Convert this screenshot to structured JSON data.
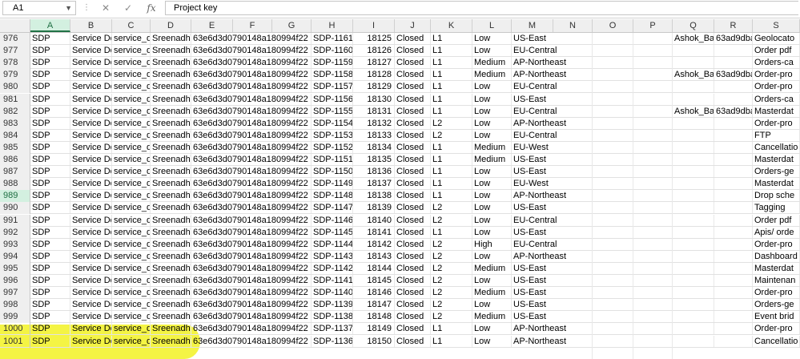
{
  "formula_bar": {
    "name_box": "A1",
    "formula": "Project key",
    "cancel_icon": "✕",
    "enter_icon": "✓",
    "function_icon": "fx"
  },
  "columns": [
    "A",
    "B",
    "C",
    "D",
    "E",
    "F",
    "G",
    "H",
    "I",
    "J",
    "K",
    "L",
    "M",
    "N",
    "O",
    "P",
    "Q",
    "R",
    "S"
  ],
  "active_column": "A",
  "active_row": "989",
  "rows": [
    {
      "n": "976",
      "a": "SDP",
      "b": "Service De",
      "c": "service_de",
      "d": "Sreenadh\\",
      "e": "63e6d3d0790148a180994f22",
      "h": "SDP-1161",
      "i": "18125",
      "j": "Closed",
      "k": "L1",
      "l": "Low",
      "m": "US-East",
      "q": "Ashok_Ba",
      "r": "63ad9dba",
      "s": "Geolocato"
    },
    {
      "n": "977",
      "a": "SDP",
      "b": "Service De",
      "c": "service_de",
      "d": "Sreenadh\\",
      "e": "63e6d3d0790148a180994f22",
      "h": "SDP-1160",
      "i": "18126",
      "j": "Closed",
      "k": "L1",
      "l": "Low",
      "m": "EU-Central",
      "q": "",
      "r": "",
      "s": "Order pdf"
    },
    {
      "n": "978",
      "a": "SDP",
      "b": "Service De",
      "c": "service_de",
      "d": "Sreenadh\\",
      "e": "63e6d3d0790148a180994f22",
      "h": "SDP-1159",
      "i": "18127",
      "j": "Closed",
      "k": "L1",
      "l": "Medium",
      "m": "AP-Northeast",
      "q": "",
      "r": "",
      "s": "Orders-ca"
    },
    {
      "n": "979",
      "a": "SDP",
      "b": "Service De",
      "c": "service_de",
      "d": "Sreenadh\\",
      "e": "63e6d3d0790148a180994f22",
      "h": "SDP-1158",
      "i": "18128",
      "j": "Closed",
      "k": "L1",
      "l": "Medium",
      "m": "AP-Northeast",
      "q": "Ashok_Ba",
      "r": "63ad9dba",
      "s": "Order-pro"
    },
    {
      "n": "980",
      "a": "SDP",
      "b": "Service De",
      "c": "service_de",
      "d": "Sreenadh\\",
      "e": "63e6d3d0790148a180994f22",
      "h": "SDP-1157",
      "i": "18129",
      "j": "Closed",
      "k": "L1",
      "l": "Low",
      "m": "EU-Central",
      "q": "",
      "r": "",
      "s": "Order-pro"
    },
    {
      "n": "981",
      "a": "SDP",
      "b": "Service De",
      "c": "service_de",
      "d": "Sreenadh\\",
      "e": "63e6d3d0790148a180994f22",
      "h": "SDP-1156",
      "i": "18130",
      "j": "Closed",
      "k": "L1",
      "l": "Low",
      "m": "US-East",
      "q": "",
      "r": "",
      "s": "Orders-ca"
    },
    {
      "n": "982",
      "a": "SDP",
      "b": "Service De",
      "c": "service_de",
      "d": "Sreenadh\\",
      "e": "63e6d3d0790148a180994f22",
      "h": "SDP-1155",
      "i": "18131",
      "j": "Closed",
      "k": "L1",
      "l": "Low",
      "m": "EU-Central",
      "q": "Ashok_Ba",
      "r": "63ad9dba",
      "s": "Masterdat"
    },
    {
      "n": "983",
      "a": "SDP",
      "b": "Service De",
      "c": "service_de",
      "d": "Sreenadh\\",
      "e": "63e6d3d0790148a180994f22",
      "h": "SDP-1154",
      "i": "18132",
      "j": "Closed",
      "k": "L2",
      "l": "Low",
      "m": "AP-Northeast",
      "q": "",
      "r": "",
      "s": "Order-pro"
    },
    {
      "n": "984",
      "a": "SDP",
      "b": "Service De",
      "c": "service_de",
      "d": "Sreenadh\\",
      "e": "63e6d3d0790148a180994f22",
      "h": "SDP-1153",
      "i": "18133",
      "j": "Closed",
      "k": "L2",
      "l": "Low",
      "m": "EU-Central",
      "q": "",
      "r": "",
      "s": "FTP"
    },
    {
      "n": "985",
      "a": "SDP",
      "b": "Service De",
      "c": "service_de",
      "d": "Sreenadh\\",
      "e": "63e6d3d0790148a180994f22",
      "h": "SDP-1152",
      "i": "18134",
      "j": "Closed",
      "k": "L1",
      "l": "Medium",
      "m": "EU-West",
      "q": "",
      "r": "",
      "s": "Cancellatio"
    },
    {
      "n": "986",
      "a": "SDP",
      "b": "Service De",
      "c": "service_de",
      "d": "Sreenadh\\",
      "e": "63e6d3d0790148a180994f22",
      "h": "SDP-1151",
      "i": "18135",
      "j": "Closed",
      "k": "L1",
      "l": "Medium",
      "m": "US-East",
      "q": "",
      "r": "",
      "s": "Masterdat"
    },
    {
      "n": "987",
      "a": "SDP",
      "b": "Service De",
      "c": "service_de",
      "d": "Sreenadh\\",
      "e": "63e6d3d0790148a180994f22",
      "h": "SDP-1150",
      "i": "18136",
      "j": "Closed",
      "k": "L1",
      "l": "Low",
      "m": "US-East",
      "q": "",
      "r": "",
      "s": "Orders-ge"
    },
    {
      "n": "988",
      "a": "SDP",
      "b": "Service De",
      "c": "service_de",
      "d": "Sreenadh\\",
      "e": "63e6d3d0790148a180994f22",
      "h": "SDP-1149",
      "i": "18137",
      "j": "Closed",
      "k": "L1",
      "l": "Low",
      "m": "EU-West",
      "q": "",
      "r": "",
      "s": "Masterdat"
    },
    {
      "n": "989",
      "a": "SDP",
      "b": "Service De",
      "c": "service_de",
      "d": "Sreenadh\\",
      "e": "63e6d3d0790148a180994f22",
      "h": "SDP-1148",
      "i": "18138",
      "j": "Closed",
      "k": "L1",
      "l": "Low",
      "m": "AP-Northeast",
      "q": "",
      "r": "",
      "s": "Drop sche"
    },
    {
      "n": "990",
      "a": "SDP",
      "b": "Service De",
      "c": "service_de",
      "d": "Sreenadh\\",
      "e": "63e6d3d0790148a180994f22",
      "h": "SDP-1147",
      "i": "18139",
      "j": "Closed",
      "k": "L2",
      "l": "Low",
      "m": "US-East",
      "q": "",
      "r": "",
      "s": "Tagging"
    },
    {
      "n": "991",
      "a": "SDP",
      "b": "Service De",
      "c": "service_de",
      "d": "Sreenadh\\",
      "e": "63e6d3d0790148a180994f22",
      "h": "SDP-1146",
      "i": "18140",
      "j": "Closed",
      "k": "L2",
      "l": "Low",
      "m": "EU-Central",
      "q": "",
      "r": "",
      "s": "Order pdf"
    },
    {
      "n": "992",
      "a": "SDP",
      "b": "Service De",
      "c": "service_de",
      "d": "Sreenadh\\",
      "e": "63e6d3d0790148a180994f22",
      "h": "SDP-1145",
      "i": "18141",
      "j": "Closed",
      "k": "L1",
      "l": "Low",
      "m": "US-East",
      "q": "",
      "r": "",
      "s": "Apis/ orde"
    },
    {
      "n": "993",
      "a": "SDP",
      "b": "Service De",
      "c": "service_de",
      "d": "Sreenadh\\",
      "e": "63e6d3d0790148a180994f22",
      "h": "SDP-1144",
      "i": "18142",
      "j": "Closed",
      "k": "L2",
      "l": "High",
      "m": "EU-Central",
      "q": "",
      "r": "",
      "s": "Order-pro"
    },
    {
      "n": "994",
      "a": "SDP",
      "b": "Service De",
      "c": "service_de",
      "d": "Sreenadh\\",
      "e": "63e6d3d0790148a180994f22",
      "h": "SDP-1143",
      "i": "18143",
      "j": "Closed",
      "k": "L2",
      "l": "Low",
      "m": "AP-Northeast",
      "q": "",
      "r": "",
      "s": "Dashboard"
    },
    {
      "n": "995",
      "a": "SDP",
      "b": "Service De",
      "c": "service_de",
      "d": "Sreenadh\\",
      "e": "63e6d3d0790148a180994f22",
      "h": "SDP-1142",
      "i": "18144",
      "j": "Closed",
      "k": "L2",
      "l": "Medium",
      "m": "US-East",
      "q": "",
      "r": "",
      "s": "Masterdat"
    },
    {
      "n": "996",
      "a": "SDP",
      "b": "Service De",
      "c": "service_de",
      "d": "Sreenadh\\",
      "e": "63e6d3d0790148a180994f22",
      "h": "SDP-1141",
      "i": "18145",
      "j": "Closed",
      "k": "L2",
      "l": "Low",
      "m": "US-East",
      "q": "",
      "r": "",
      "s": "Maintenan"
    },
    {
      "n": "997",
      "a": "SDP",
      "b": "Service De",
      "c": "service_de",
      "d": "Sreenadh\\",
      "e": "63e6d3d0790148a180994f22",
      "h": "SDP-1140",
      "i": "18146",
      "j": "Closed",
      "k": "L2",
      "l": "Medium",
      "m": "US-East",
      "q": "",
      "r": "",
      "s": "Order-pro"
    },
    {
      "n": "998",
      "a": "SDP",
      "b": "Service De",
      "c": "service_de",
      "d": "Sreenadh\\",
      "e": "63e6d3d0790148a180994f22",
      "h": "SDP-1139",
      "i": "18147",
      "j": "Closed",
      "k": "L2",
      "l": "Low",
      "m": "US-East",
      "q": "",
      "r": "",
      "s": "Orders-ge"
    },
    {
      "n": "999",
      "a": "SDP",
      "b": "Service De",
      "c": "service_de",
      "d": "Sreenadh\\",
      "e": "63e6d3d0790148a180994f22",
      "h": "SDP-1138",
      "i": "18148",
      "j": "Closed",
      "k": "L2",
      "l": "Medium",
      "m": "US-East",
      "q": "",
      "r": "",
      "s": "Event brid"
    },
    {
      "n": "1000",
      "a": "SDP",
      "b": "Service De",
      "c": "service_de",
      "d": "Sreenadh\\",
      "e": "63e6d3d0790148a180994f22",
      "h": "SDP-1137",
      "i": "18149",
      "j": "Closed",
      "k": "L1",
      "l": "Low",
      "m": "AP-Northeast",
      "q": "",
      "r": "",
      "s": "Order-pro"
    },
    {
      "n": "1001",
      "a": "SDP",
      "b": "Service De",
      "c": "service_de",
      "d": "Sreenadh\\",
      "e": "63e6d3d0790148a180994f22",
      "h": "SDP-1136",
      "i": "18150",
      "j": "Closed",
      "k": "L1",
      "l": "Low",
      "m": "AP-Northeast",
      "q": "",
      "r": "",
      "s": "Cancellatio"
    }
  ],
  "colors": {
    "highlight": "#f3f32a",
    "active_header": "#d3f0e0"
  }
}
